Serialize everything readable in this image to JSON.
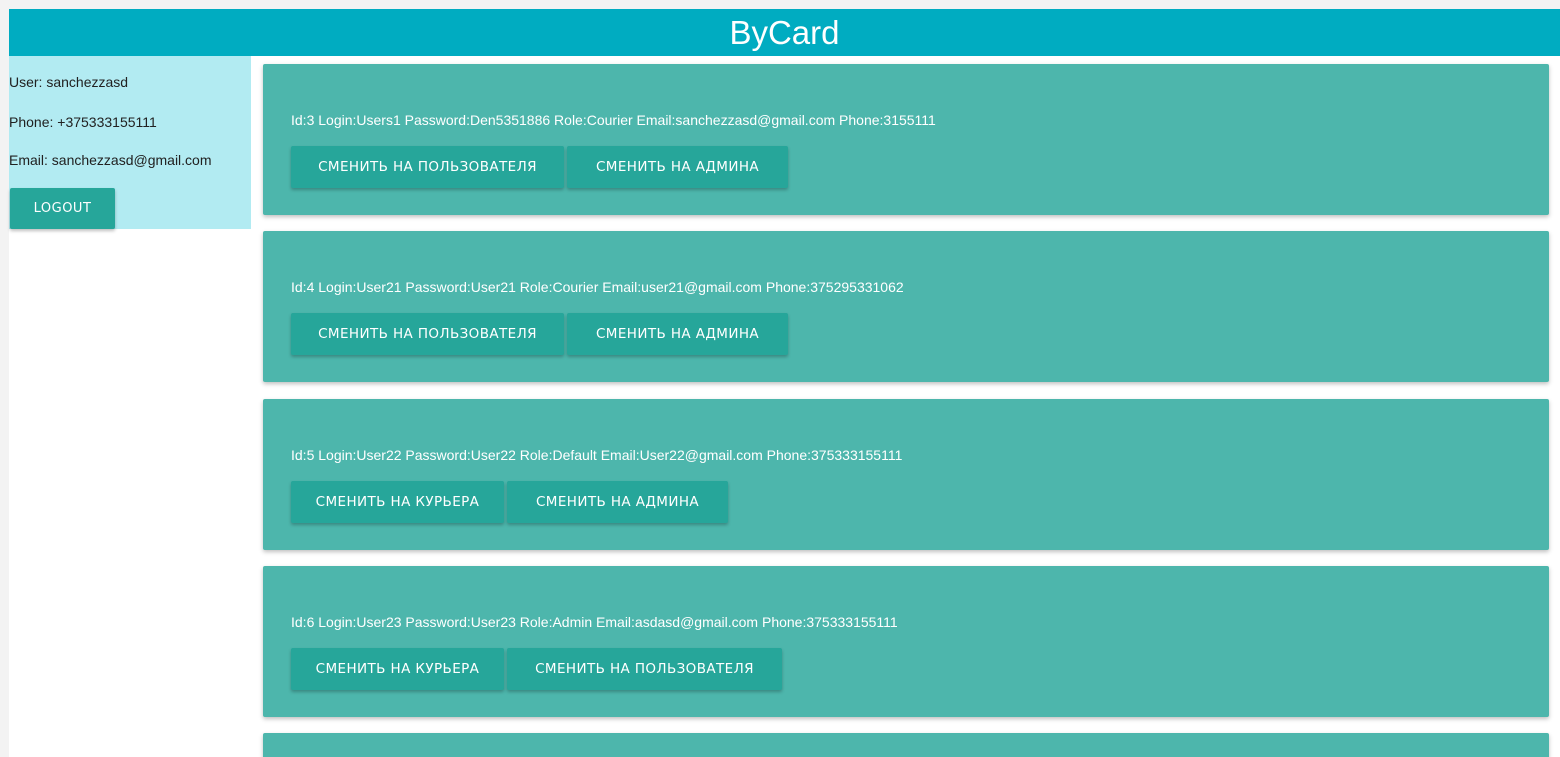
{
  "header": {
    "title": "ByCard"
  },
  "sidebar": {
    "user_line": "User: sanchezzasd",
    "phone_line": "Phone: +375333155111",
    "email_line": "Email: sanchezzasd@gmail.com",
    "logout_label": "LOGOUT"
  },
  "users": [
    {
      "info": "Id:3 Login:Users1 Password:Den5351886 Role:Courier Email:sanchezzasd@gmail.com Phone:3155111",
      "buttons": [
        "СМЕНИТЬ НА ПОЛЬЗОВАТЕЛЯ",
        "СМЕНИТЬ НА АДМИНА"
      ]
    },
    {
      "info": "Id:4 Login:User21 Password:User21 Role:Courier Email:user21@gmail.com Phone:375295331062",
      "buttons": [
        "СМЕНИТЬ НА ПОЛЬЗОВАТЕЛЯ",
        "СМЕНИТЬ НА АДМИНА"
      ]
    },
    {
      "info": "Id:5 Login:User22 Password:User22 Role:Default Email:User22@gmail.com Phone:375333155111",
      "buttons": [
        "СМЕНИТЬ НА КУРЬЕРА",
        "СМЕНИТЬ НА АДМИНА"
      ]
    },
    {
      "info": "Id:6 Login:User23 Password:User23 Role:Admin Email:asdasd@gmail.com Phone:375333155111",
      "buttons": [
        "СМЕНИТЬ НА КУРЬЕРА",
        "СМЕНИТЬ НА ПОЛЬЗОВАТЕЛЯ"
      ]
    }
  ],
  "colors": {
    "header": "#00acc1",
    "sidebar": "#b2ebf2",
    "card": "#4db6ac",
    "button": "#26a69a"
  }
}
